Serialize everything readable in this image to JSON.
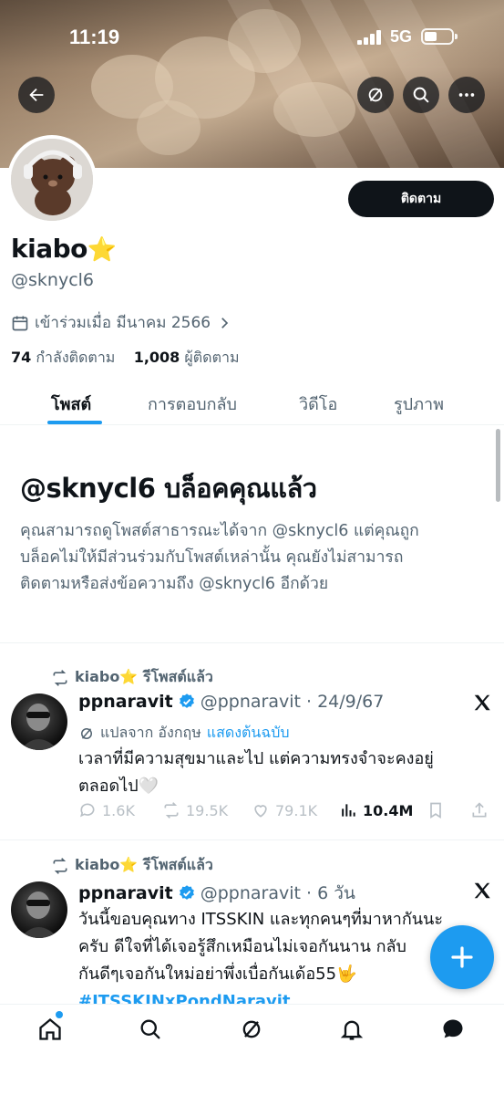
{
  "status_bar": {
    "time": "11:19",
    "network": "5G",
    "battery_level": 0.45
  },
  "header": {
    "back_icon": "arrow-left-icon",
    "grok_icon": "grok-icon",
    "search_icon": "search-icon",
    "more_icon": "more-icon"
  },
  "profile": {
    "display_name": "kiabo",
    "name_emoji": "⭐",
    "handle": "@sknycl6",
    "follow_button": "ติดตาม",
    "joined": "เข้าร่วมเมื่อ มีนาคม 2566",
    "following_count": "74",
    "following_label": "กำลังติดตาม",
    "followers_count": "1,008",
    "followers_label": "ผู้ติดตาม"
  },
  "tabs": [
    {
      "label": "โพสต์",
      "active": true
    },
    {
      "label": "การตอบกลับ",
      "active": false
    },
    {
      "label": "วิดีโอ",
      "active": false
    },
    {
      "label": "รูปภาพ",
      "active": false
    }
  ],
  "blocked": {
    "title": "@sknycl6 บล็อคคุณแล้ว",
    "line1": "คุณสามารถดูโพสต์สาธารณะได้จาก @sknycl6 แต่คุณถูก",
    "line2": "บล็อคไม่ให้มีส่วนร่วมกับโพสต์เหล่านั้น คุณยังไม่สามารถ",
    "line3": "ติดตามหรือส่งข้อความถึง @sknycl6 อีกด้วย"
  },
  "posts": [
    {
      "repost_by": "kiabo⭐ รีโพสต์แล้ว",
      "author": "ppnaravit",
      "handle_time": "@ppnaravit · 24/9/67",
      "translate_prefix": "แปลจาก อังกฤษ",
      "translate_link": "แสดงต้นฉบับ",
      "line1": "เวลาที่มีความสุขมาและไป แต่ความทรงจำจะคงอยู่",
      "line2": "ตลอดไป🤍",
      "replies": "1.6K",
      "reposts": "19.5K",
      "likes": "79.1K",
      "views": "10.4M"
    },
    {
      "repost_by": "kiabo⭐ รีโพสต์แล้ว",
      "author": "ppnaravit",
      "handle_time": "@ppnaravit · 6 วัน",
      "line1": "วันนี้ขอบคุณทาง ITSSKIN และทุกคนๆที่มาหากันนะ",
      "line2": "ครับ ดีใจที่ได้เจอรู้สึกเหมือนไม่เจอกันนาน กลับ",
      "line3": "กันดีๆเจอกันใหม่อย่าพึ่งเบื่อกันเด้อ55🤟",
      "hashtag": "#ITSSKINxPondNaravit"
    }
  ],
  "bottom_nav": [
    "home-icon",
    "search-icon",
    "grok-icon",
    "notifications-icon",
    "messages-icon"
  ],
  "colors": {
    "accent": "#1d9bf0",
    "text": "#0f1419",
    "secondary": "#536471",
    "star": "#f5c518"
  }
}
